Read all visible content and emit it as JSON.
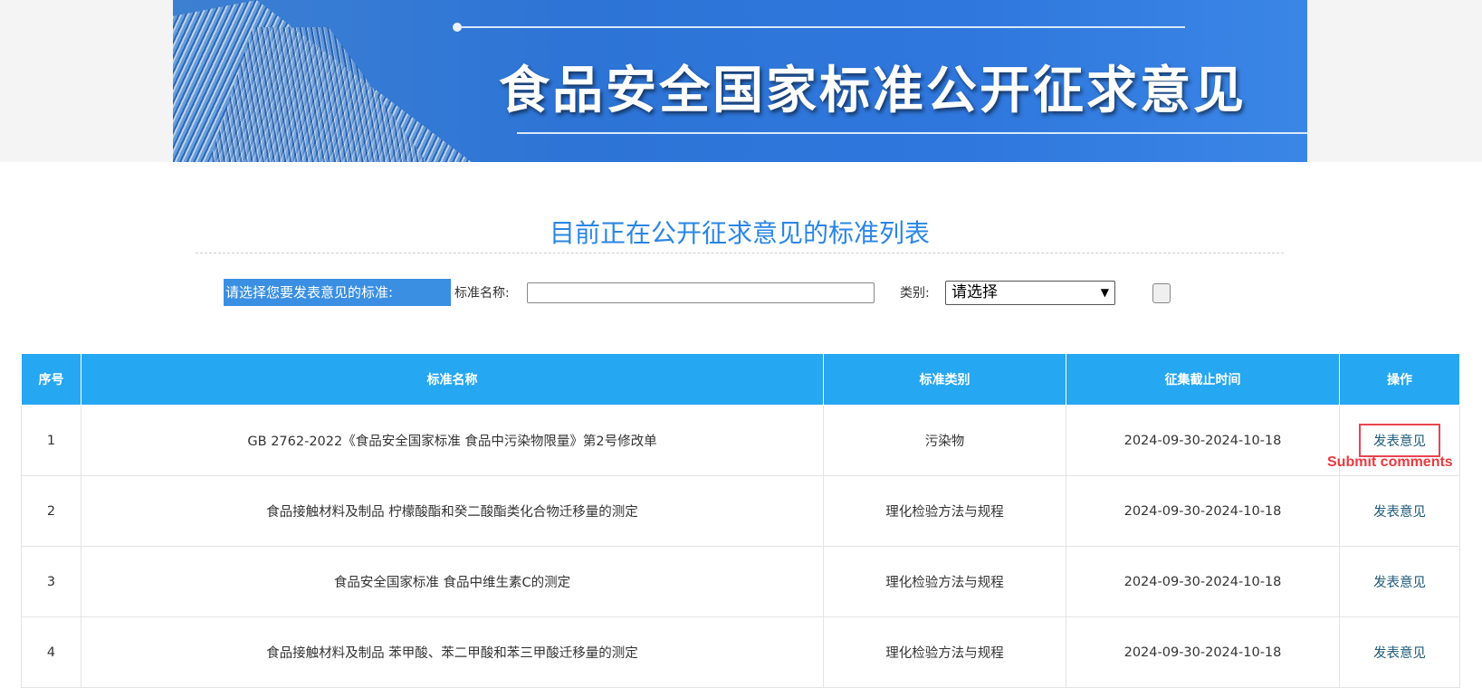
{
  "banner": {
    "title": "食品安全国家标准公开征求意见"
  },
  "list_title": "目前正在公开征求意见的标准列表",
  "filter": {
    "section_label": "请选择您要发表意见的标准:",
    "name_label": "标准名称:",
    "name_value": "",
    "category_label": "类别:",
    "category_selected": "请选择"
  },
  "table": {
    "headers": [
      "序号",
      "标准名称",
      "标准类别",
      "征集截止时间",
      "操作"
    ],
    "rows": [
      {
        "no": "1",
        "name": "GB 2762-2022《食品安全国家标准 食品中污染物限量》第2号修改单",
        "category": "污染物",
        "deadline": "2024-09-30-2024-10-18",
        "action": "发表意见"
      },
      {
        "no": "2",
        "name": "食品接触材料及制品 柠檬酸酯和癸二酸酯类化合物迁移量的测定",
        "category": "理化检验方法与规程",
        "deadline": "2024-09-30-2024-10-18",
        "action": "发表意见"
      },
      {
        "no": "3",
        "name": "食品安全国家标准 食品中维生素C的测定",
        "category": "理化检验方法与规程",
        "deadline": "2024-09-30-2024-10-18",
        "action": "发表意见"
      },
      {
        "no": "4",
        "name": "食品接触材料及制品 苯甲酸、苯二甲酸和苯三甲酸迁移量的测定",
        "category": "理化检验方法与规程",
        "deadline": "2024-09-30-2024-10-18",
        "action": "发表意见"
      }
    ]
  },
  "annotation": {
    "text": "Submit comments",
    "color": "#ea3a3f"
  },
  "colors": {
    "header_bg": "#25a7f2",
    "title_blue": "#2a86e5",
    "filter_label_bg": "#3a8fe3"
  }
}
